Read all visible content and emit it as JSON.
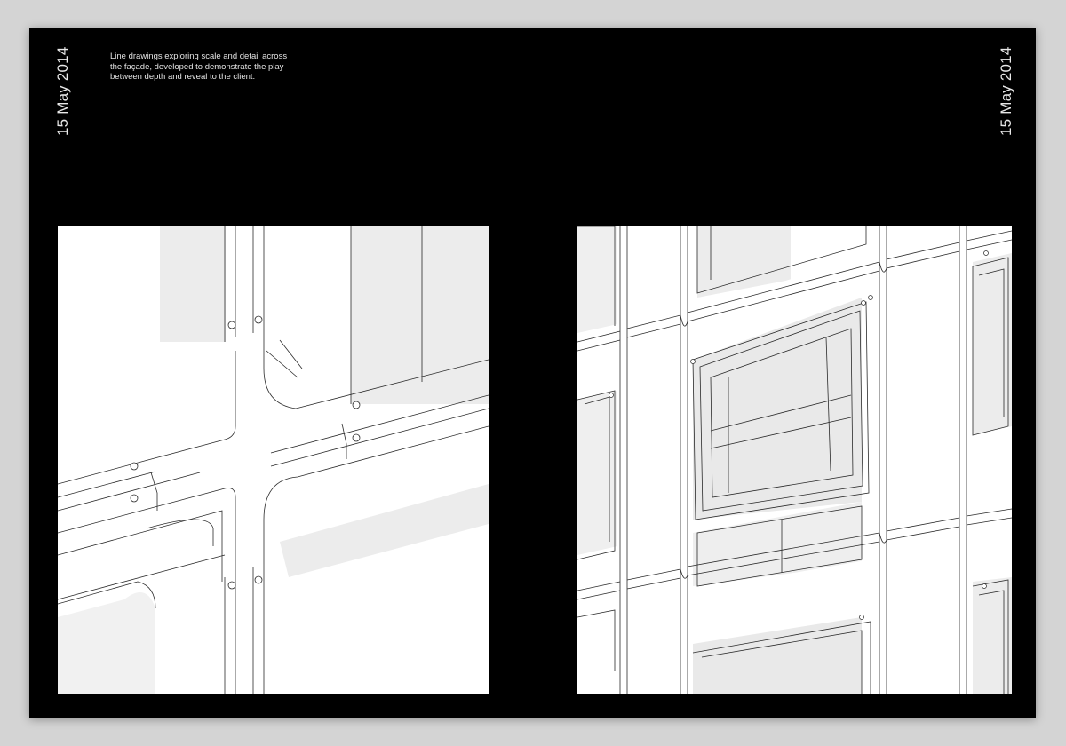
{
  "spread": {
    "date_left": "15 May 2014",
    "date_right": "15 May 2014",
    "caption_lines": [
      "Line drawings exploring scale and detail across",
      "the façade, developed to demonstrate the play",
      "between depth and reveal to the client."
    ]
  },
  "colors": {
    "page_background": "#000000",
    "surround": "#d4d4d4",
    "text": "#e8e8e8",
    "drawing_fill": "#ffffff",
    "drawing_shade": "#ececec",
    "drawing_line": "#2a2a2a"
  },
  "images": {
    "left": "facade-node-detail-line-drawing",
    "right": "facade-window-grid-line-drawing"
  }
}
